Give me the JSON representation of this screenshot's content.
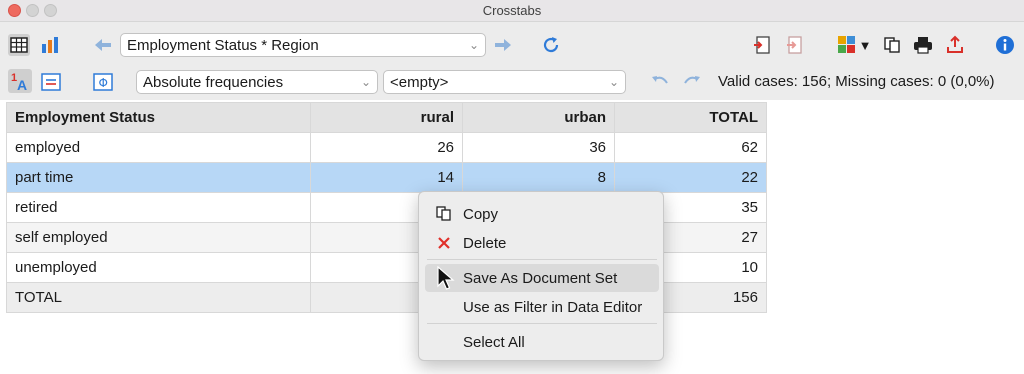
{
  "window": {
    "title": "Crosstabs"
  },
  "toolbar": {
    "table_combo": "Employment Status * Region",
    "mode_combo": "Absolute frequencies",
    "filter_combo": "<empty>",
    "status_text": "Valid cases: 156;  Missing cases: 0 (0,0%)",
    "icons": {
      "table_view": "table-icon",
      "chart_view": "bar-chart-icon",
      "back": "arrow-left-icon",
      "forward": "arrow-right-icon",
      "refresh": "refresh-icon",
      "export_in": "import-icon",
      "export_out": "export-icon",
      "puzzle": "puzzle-icon",
      "copy": "copy-icon",
      "print": "print-icon",
      "share": "share-icon",
      "info": "info-icon",
      "sort": "sort-icon",
      "layout": "layout-icon",
      "phi": "phi-icon",
      "undo": "undo-icon",
      "redo": "redo-icon"
    }
  },
  "table": {
    "headers": [
      "Employment Status",
      "rural",
      "urban",
      "TOTAL"
    ],
    "rows": [
      {
        "label": "employed",
        "rural": "26",
        "urban": "36",
        "total": "62"
      },
      {
        "label": "part time",
        "rural": "14",
        "urban": "8",
        "total": "22"
      },
      {
        "label": "retired",
        "rural": "",
        "urban": "",
        "total": "35"
      },
      {
        "label": "self employed",
        "rural": "",
        "urban": "",
        "total": "27"
      },
      {
        "label": "unemployed",
        "rural": "",
        "urban": "",
        "total": "10"
      },
      {
        "label": "TOTAL",
        "rural": "",
        "urban": "",
        "total": "156"
      }
    ]
  },
  "context_menu": {
    "items": [
      {
        "label": "Copy",
        "icon": "copy-icon"
      },
      {
        "label": "Delete",
        "icon": "delete-x-icon"
      },
      {
        "label": "Save As Document Set",
        "icon": ""
      },
      {
        "label": "Use as Filter in Data Editor",
        "icon": ""
      },
      {
        "label": "Select All",
        "icon": ""
      }
    ]
  },
  "colors": {
    "selected_row": "#b7d7f6",
    "accent_blue": "#2f7bd8",
    "delete_red": "#e0302a"
  }
}
